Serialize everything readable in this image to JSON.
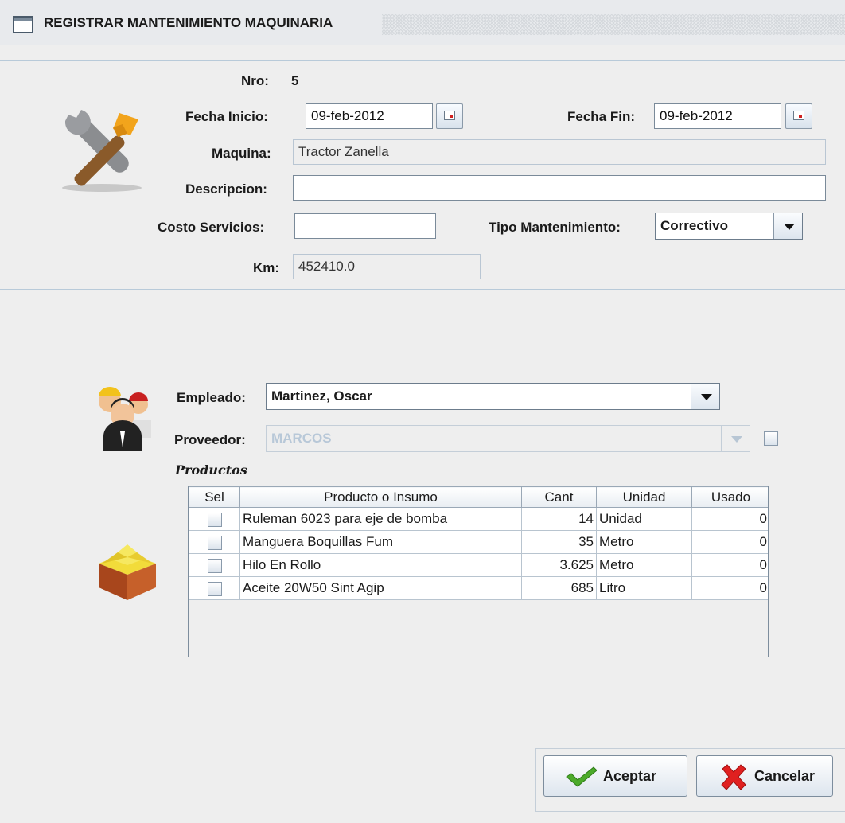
{
  "window": {
    "title": "REGISTRAR MANTENIMIENTO MAQUINARIA"
  },
  "form": {
    "nro_label": "Nro:",
    "nro_value": "5",
    "fecha_inicio_label": "Fecha Inicio:",
    "fecha_inicio_value": "09-feb-2012",
    "fecha_fin_label": "Fecha Fin:",
    "fecha_fin_value": "09-feb-2012",
    "maquina_label": "Maquina:",
    "maquina_value": "Tractor Zanella",
    "descripcion_label": "Descripcion:",
    "descripcion_value": "",
    "costo_label": "Costo Servicios:",
    "costo_value": "",
    "tipo_label": "Tipo Mantenimiento:",
    "tipo_value": "Correctivo",
    "km_label": "Km:",
    "km_value": "452410.0"
  },
  "assign": {
    "empleado_label": "Empleado:",
    "empleado_value": "Martinez, Oscar",
    "proveedor_label": "Proveedor:",
    "proveedor_value": "MARCOS",
    "productos_label": "Productos"
  },
  "table": {
    "headers": [
      "Sel",
      "Producto o Insumo",
      "Cant",
      "Unidad",
      "Usado"
    ],
    "rows": [
      {
        "producto": "Ruleman 6023 para eje de bomba",
        "cant": "14",
        "unidad": "Unidad",
        "usado": "0"
      },
      {
        "producto": "Manguera Boquillas Fum",
        "cant": "35",
        "unidad": "Metro",
        "usado": "0"
      },
      {
        "producto": "Hilo En Rollo",
        "cant": "3.625",
        "unidad": "Metro",
        "usado": "0"
      },
      {
        "producto": "Aceite 20W50 Sint Agip",
        "cant": "685",
        "unidad": "Litro",
        "usado": "0"
      }
    ]
  },
  "buttons": {
    "aceptar": "Aceptar",
    "cancelar": "Cancelar"
  },
  "icons": {
    "window": "window-icon",
    "tools": "tools-icon",
    "employees": "employees-icon",
    "box": "box-icon",
    "check": "check-icon",
    "cancel": "cancel-x-icon"
  },
  "colors": {
    "background": "#eeeeee",
    "separator": "#b8cad9",
    "disabled_text": "#b8c8d8"
  }
}
